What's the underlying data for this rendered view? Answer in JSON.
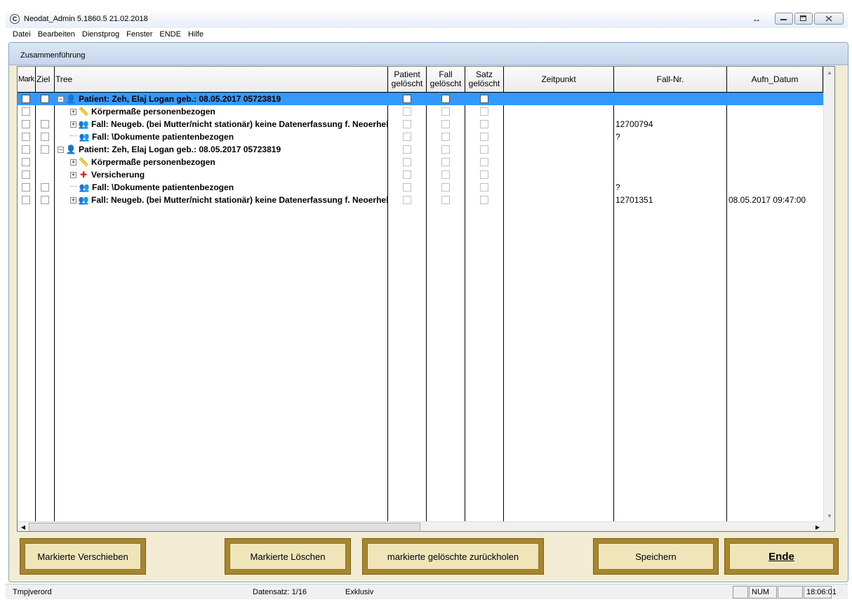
{
  "window": {
    "title": "Neodat_Admin 5.1860.5 21.02.2018",
    "resize_glyph": "↔",
    "app_icon_glyph": "C"
  },
  "menu": [
    "Datei",
    "Bearbeiten",
    "Dienstprog",
    "Fenster",
    "ENDE",
    "Hilfe"
  ],
  "panel": {
    "title": "Zusammenführung"
  },
  "grid": {
    "columns": {
      "mark": "Mark",
      "ziel": "Ziel",
      "tree": "Tree",
      "patient_deleted": "Patient gelöscht",
      "fall_deleted": "Fall gelöscht",
      "satz_deleted": "Satz gelöscht",
      "zeitpunkt": "Zeitpunkt",
      "fall_nr": "Fall-Nr.",
      "aufn_datum": "Aufn_Datum"
    },
    "rows": [
      {
        "label": "Patient: Zeh, Elaj Logan geb.: 08.05.2017 05723819",
        "icon": "patient-icon",
        "expander": "−",
        "fall_nr": "",
        "aufn_datum": "",
        "selected": true
      },
      {
        "label": "Körpermaße personenbezogen",
        "icon": "ruler-icon",
        "expander": "+",
        "fall_nr": "",
        "aufn_datum": "",
        "selected": false
      },
      {
        "label": "Fall: Neugeb. (bei Mutter/nicht stationär) keine Datenerfassung f. Neoerheb",
        "icon": "case-icon",
        "expander": "+",
        "fall_nr": "12700794",
        "aufn_datum": "",
        "selected": false
      },
      {
        "label": "Fall: \\Dokumente patientenbezogen",
        "icon": "case-icon",
        "expander": "",
        "fall_nr": "?",
        "aufn_datum": "",
        "selected": false
      },
      {
        "label": "Patient: Zeh, Elaj Logan geb.: 08.05.2017 05723819",
        "icon": "patient-icon",
        "expander": "−",
        "fall_nr": "",
        "aufn_datum": "",
        "selected": false
      },
      {
        "label": "Körpermaße personenbezogen",
        "icon": "ruler-icon",
        "expander": "+",
        "fall_nr": "",
        "aufn_datum": "",
        "selected": false
      },
      {
        "label": "Versicherung",
        "icon": "insurance-icon",
        "expander": "+",
        "fall_nr": "",
        "aufn_datum": "",
        "selected": false
      },
      {
        "label": "Fall: \\Dokumente patientenbezogen",
        "icon": "case-icon",
        "expander": "",
        "fall_nr": "?",
        "aufn_datum": "",
        "selected": false
      },
      {
        "label": "Fall: Neugeb. (bei Mutter/nicht stationär) keine Datenerfassung f. Neoerheb",
        "icon": "case-icon",
        "expander": "+",
        "fall_nr": "12701351",
        "aufn_datum": "08.05.2017 09:47:00",
        "selected": false
      }
    ]
  },
  "buttons": {
    "move_marked": "Markierte Verschieben",
    "delete_marked": "Markierte Löschen",
    "restore_deleted": "markierte gelöschte zurückholen",
    "save": "Speichern",
    "end": "Ende"
  },
  "statusbar": {
    "left": "Tmpjverord",
    "record": "Datensatz: 1/16",
    "mode": "Exklusiv",
    "num": "NUM",
    "time": "18:06:01"
  },
  "colors": {
    "selection": "#3399ff",
    "panel_bg": "#f3ecd4",
    "button_frame": "#a8862e",
    "button_face": "#efe5b9"
  }
}
